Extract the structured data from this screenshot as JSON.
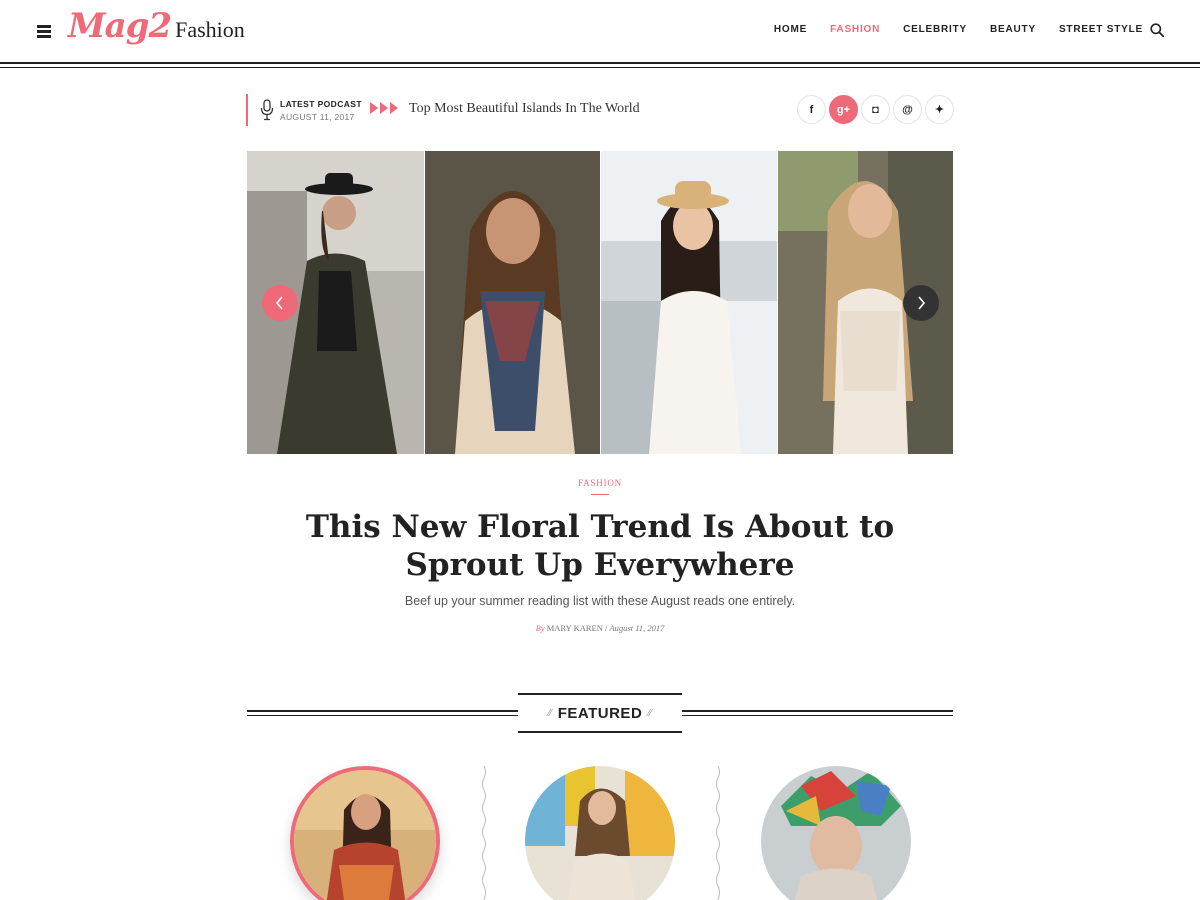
{
  "header": {
    "logo_script": "Mag2",
    "logo_word": "Fashion",
    "nav": [
      "HOME",
      "FASHION",
      "CELEBRITY",
      "BEAUTY",
      "STREET STYLE"
    ],
    "active_nav": "FASHION"
  },
  "podcast": {
    "label": "LATEST PODCAST",
    "date": "AUGUST 11, 2017",
    "headline": "Top Most Beautiful Islands In The World"
  },
  "socials": [
    {
      "icon": "facebook-icon",
      "glyph": "f"
    },
    {
      "icon": "google-plus-icon",
      "glyph": "g+"
    },
    {
      "icon": "instagram-icon",
      "glyph": "◘"
    },
    {
      "icon": "email-icon",
      "glyph": "@"
    },
    {
      "icon": "twitter-icon",
      "glyph": "✦"
    }
  ],
  "feature": {
    "category": "FASHION",
    "title": "This New Floral Trend Is About to Sprout Up Everywhere",
    "subtitle": "Beef up your summer reading list with these August reads one entirely.",
    "by": "By",
    "author": "MARY KAREN",
    "date": "August 11, 2017"
  },
  "featured_section": {
    "label": "FEATURED"
  },
  "colors": {
    "accent": "#ee6a78",
    "text": "#222222"
  }
}
